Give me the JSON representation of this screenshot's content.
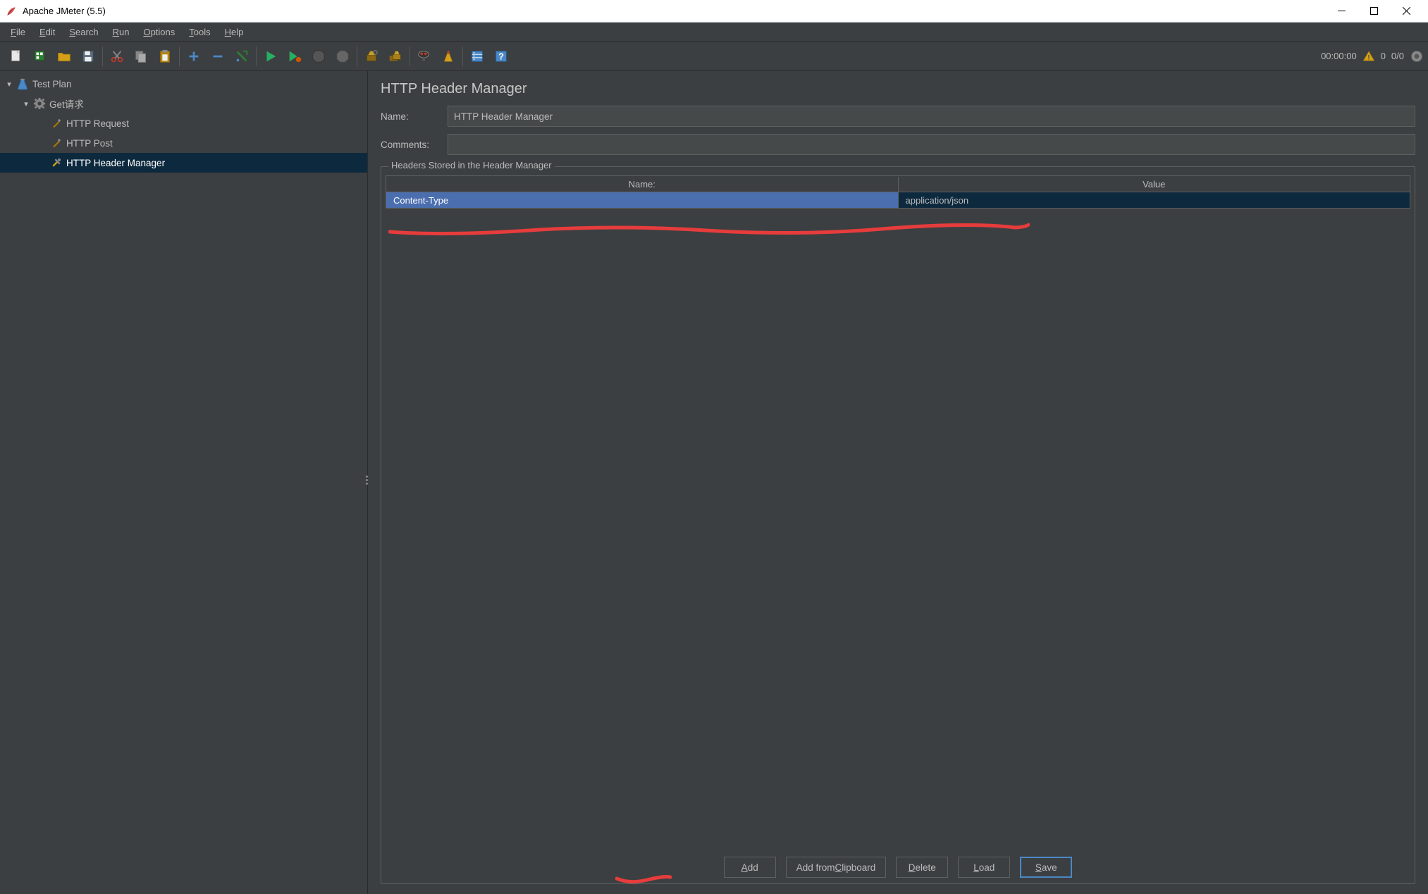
{
  "window": {
    "title": "Apache JMeter (5.5)"
  },
  "menubar": [
    "File",
    "Edit",
    "Search",
    "Run",
    "Options",
    "Tools",
    "Help"
  ],
  "toolbar_status": {
    "timer": "00:00:00",
    "count1": "0",
    "count2": "0/0"
  },
  "tree": {
    "root": "Test Plan",
    "child": "Get请求",
    "leaves": [
      "HTTP Request",
      "HTTP Post",
      "HTTP Header Manager"
    ],
    "selected_index": 2
  },
  "editor": {
    "title": "HTTP Header Manager",
    "name_label": "Name:",
    "name_value": "HTTP Header Manager",
    "comments_label": "Comments:",
    "comments_value": "",
    "fieldset_label": "Headers Stored in the Header Manager",
    "columns": {
      "name": "Name:",
      "value": "Value"
    },
    "rows": [
      {
        "name": "Content-Type",
        "value": "application/json"
      }
    ],
    "buttons": {
      "add": "Add",
      "add_clipboard": "Add from Clipboard",
      "delete": "Delete",
      "load": "Load",
      "save": "Save"
    }
  }
}
